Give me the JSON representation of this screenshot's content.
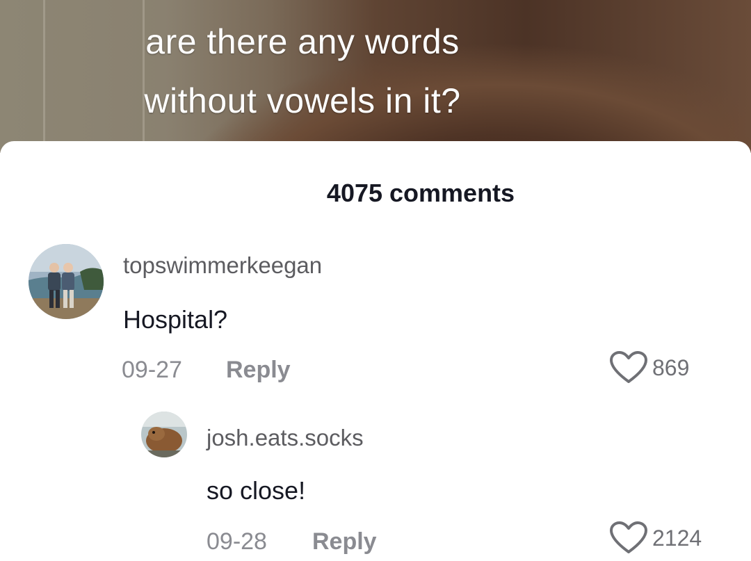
{
  "video": {
    "caption_line1": "are there any words",
    "caption_line2": "without vowels in it?"
  },
  "comments_sheet": {
    "count_label": "4075 comments",
    "comments": [
      {
        "username": "topswimmerkeegan",
        "text": "Hospital?",
        "date": "09-27",
        "reply_label": "Reply",
        "likes": "869"
      }
    ],
    "replies": [
      {
        "username": "josh.eats.socks",
        "text": "so close!",
        "date": "09-28",
        "reply_label": "Reply",
        "likes": "2124"
      }
    ]
  },
  "colors": {
    "text_primary": "#161823",
    "text_secondary": "#8a8b91",
    "sheet_background": "#ffffff"
  },
  "icons": [
    "heart-outline-icon"
  ]
}
